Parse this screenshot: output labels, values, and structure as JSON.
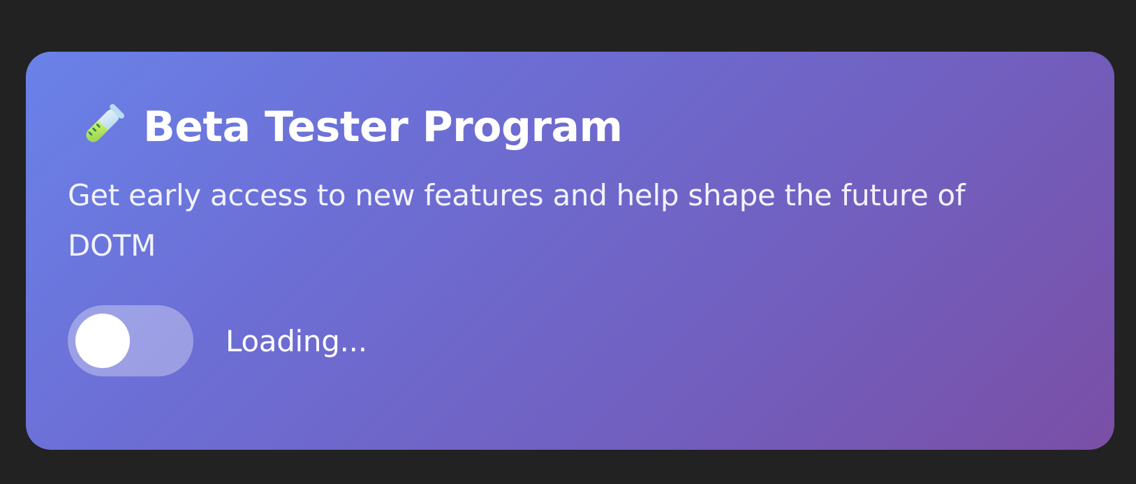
{
  "card": {
    "icon": "test-tube-icon",
    "title": "Beta Tester Program",
    "description": "Get early access to new features and help shape the future of DOTM"
  },
  "toggle": {
    "enabled": false,
    "status_text": "Loading..."
  },
  "colors": {
    "background": "#222222",
    "gradient_start": "#6a82e8",
    "gradient_end": "#7a4fa6",
    "text": "#ffffff"
  }
}
